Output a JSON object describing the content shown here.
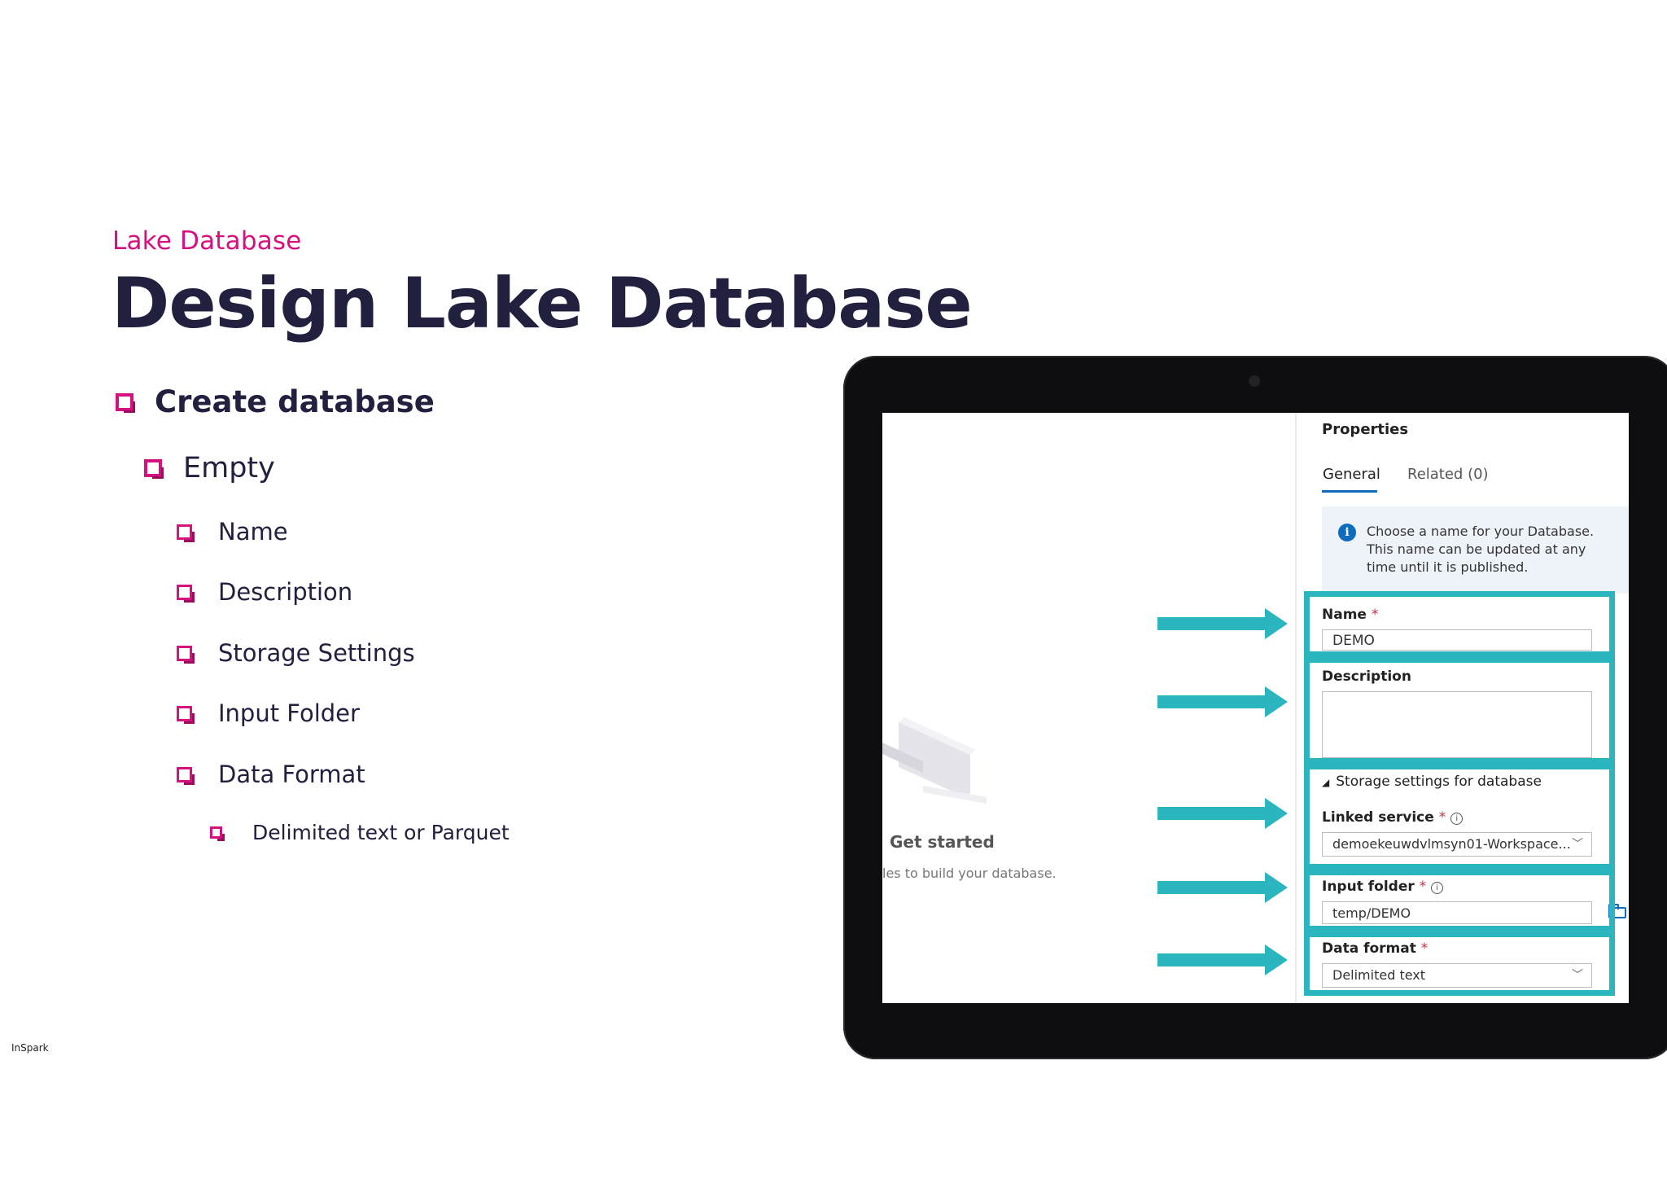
{
  "slide": {
    "kicker": "Lake Database",
    "title": "Design Lake Database",
    "bullets": {
      "create": "Create database",
      "empty": "Empty",
      "name": "Name",
      "description": "Description",
      "storage": "Storage Settings",
      "input_folder": "Input Folder",
      "data_format": "Data Format",
      "format_detail": "Delimited text or Parquet"
    },
    "footer": "InSpark"
  },
  "screen": {
    "get_started": "Get started",
    "get_started_sub": "les to build your database.",
    "properties_title": "Properties",
    "tabs": {
      "general": "General",
      "related": "Related (0)"
    },
    "info": "Choose a name for your Database. This name can be updated at any time until it is published.",
    "fields": {
      "name_label": "Name",
      "name_value": "DEMO",
      "description_label": "Description",
      "storage_header": "Storage settings for database",
      "linked_service_label": "Linked service",
      "linked_service_value": "demoekeuwdvlmsyn01-Workspace...",
      "input_folder_label": "Input folder",
      "input_folder_value": "temp/DEMO",
      "data_format_label": "Data format",
      "data_format_value": "Delimited text"
    },
    "required_mark": "*"
  },
  "colors": {
    "accent": "#d4117f",
    "title": "#22203f",
    "highlight": "#2bb5be",
    "link": "#0f6cbd"
  },
  "icons": [
    "checkbox-bullet-icon",
    "info-icon",
    "chevron-down-icon",
    "folder-icon",
    "arrow-right-icon",
    "collapse-triangle-icon"
  ]
}
